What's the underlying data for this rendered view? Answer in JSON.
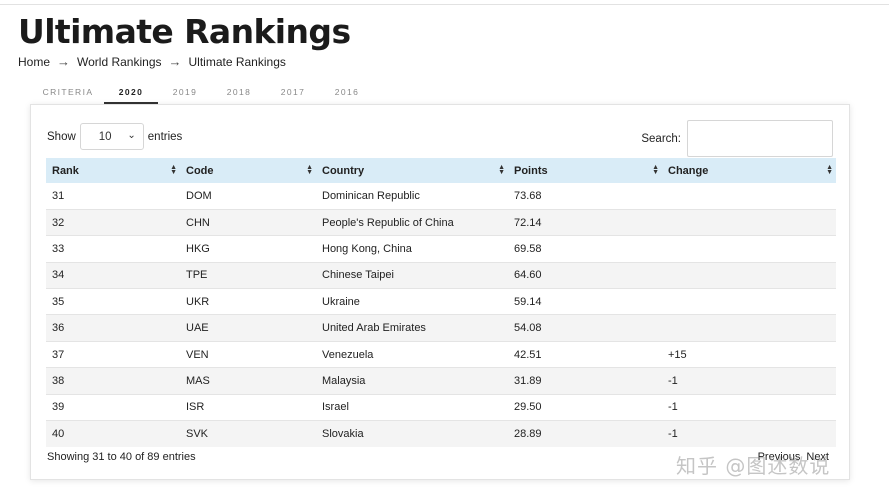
{
  "page": {
    "title": "Ultimate Rankings",
    "breadcrumb": [
      "Home",
      "World Rankings",
      "Ultimate Rankings"
    ]
  },
  "tabs": [
    "CRITERIA",
    "2020",
    "2019",
    "2018",
    "2017",
    "2016"
  ],
  "active_tab": "2020",
  "controls": {
    "show_label": "Show",
    "entries_value": "10",
    "entries_label": "entries",
    "search_label": "Search:",
    "search_value": ""
  },
  "table": {
    "columns": [
      "Rank",
      "Code",
      "Country",
      "Points",
      "Change"
    ],
    "rows": [
      [
        "31",
        "DOM",
        "Dominican Republic",
        "73.68",
        ""
      ],
      [
        "32",
        "CHN",
        "People's Republic of China",
        "72.14",
        ""
      ],
      [
        "33",
        "HKG",
        "Hong Kong, China",
        "69.58",
        ""
      ],
      [
        "34",
        "TPE",
        "Chinese Taipei",
        "64.60",
        ""
      ],
      [
        "35",
        "UKR",
        "Ukraine",
        "59.14",
        ""
      ],
      [
        "36",
        "UAE",
        "United Arab Emirates",
        "54.08",
        ""
      ],
      [
        "37",
        "VEN",
        "Venezuela",
        "42.51",
        "+15"
      ],
      [
        "38",
        "MAS",
        "Malaysia",
        "31.89",
        "-1"
      ],
      [
        "39",
        "ISR",
        "Israel",
        "29.50",
        "-1"
      ],
      [
        "40",
        "SVK",
        "Slovakia",
        "28.89",
        "-1"
      ]
    ]
  },
  "footer": {
    "info": "Showing 31 to 40 of 89 entries",
    "prev_label": "Previous",
    "next_label": "Next"
  },
  "watermark": "知乎 @图述数说",
  "colors": {
    "header_row": "#d9ecf7",
    "stripe_row": "#f4f4f4"
  }
}
